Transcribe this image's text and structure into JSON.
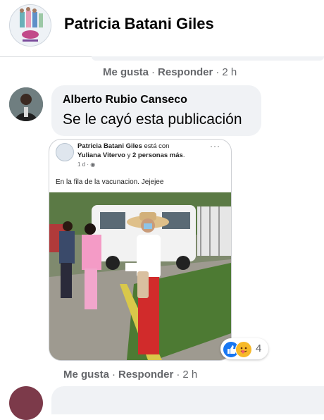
{
  "header": {
    "title": "Patricia Batani Giles"
  },
  "top_actions": {
    "like": "Me gusta",
    "sep": "·",
    "reply": "Responder",
    "sep2": "·",
    "time": "2 h"
  },
  "comment": {
    "author": "Alberto Rubio Canseco",
    "text": "Se le cayó esta publicación"
  },
  "attached_post": {
    "author": "Patricia Batani Giles",
    "with_text": "está con",
    "tagged": "Yuliana Vitervo",
    "and_text": "y",
    "others": "2 personas más",
    "end_dot": ".",
    "time": "1 d ·",
    "more": "···",
    "caption": "En la fila de la vacunacion. Jejejee"
  },
  "reactions": {
    "count": "4",
    "icons": [
      "like-icon",
      "care-icon"
    ]
  },
  "bottom_actions": {
    "like": "Me gusta",
    "sep": "·",
    "reply": "Responder",
    "sep2": "·",
    "time": "2 h"
  },
  "colors": {
    "link_gray": "#65676b",
    "bubble": "#f0f2f5",
    "like_blue": "#1877f2"
  }
}
